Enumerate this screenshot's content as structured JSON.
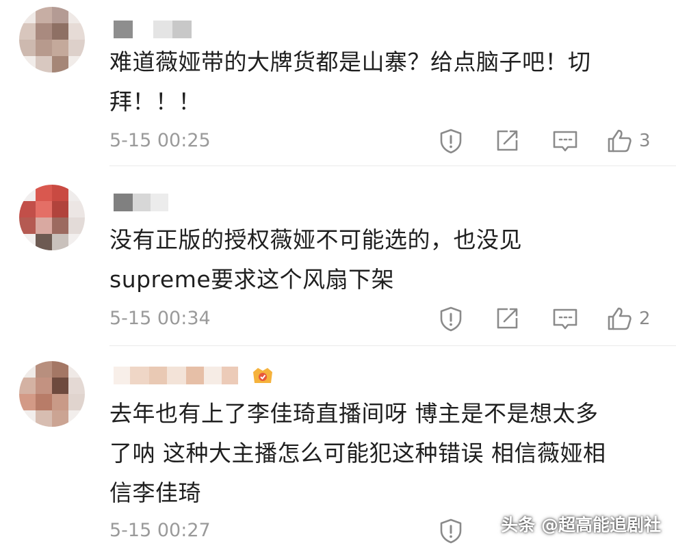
{
  "comments": [
    {
      "text_line1": "难道薇娅带的大牌货都是山寨？给点脑子吧！切",
      "text_line2": "拜！！！",
      "time": "5-15 00:25",
      "likes": "3"
    },
    {
      "text_line1": "没有正版的授权薇娅不可能选的，也没见",
      "text_line2": "supreme要求这个风扇下架",
      "time": "5-15 00:34",
      "likes": "2"
    },
    {
      "text_line1": "去年也有上了李佳琦直播间呀 博主是不是想太多",
      "text_line2": "了呐 这种大主播怎么可能犯这种错误 相信薇娅相",
      "text_line3": "信李佳琦",
      "time": "5-15 00:27",
      "likes": ""
    }
  ],
  "icons": [
    "report-icon",
    "share-icon",
    "reply-icon",
    "like-icon"
  ],
  "watermark": "头条 @超高能追剧社",
  "colors": {
    "text": "#1f1f1f",
    "meta": "#9a9a9a",
    "icon": "#8a8a8a",
    "divider": "#e9e9e9"
  }
}
